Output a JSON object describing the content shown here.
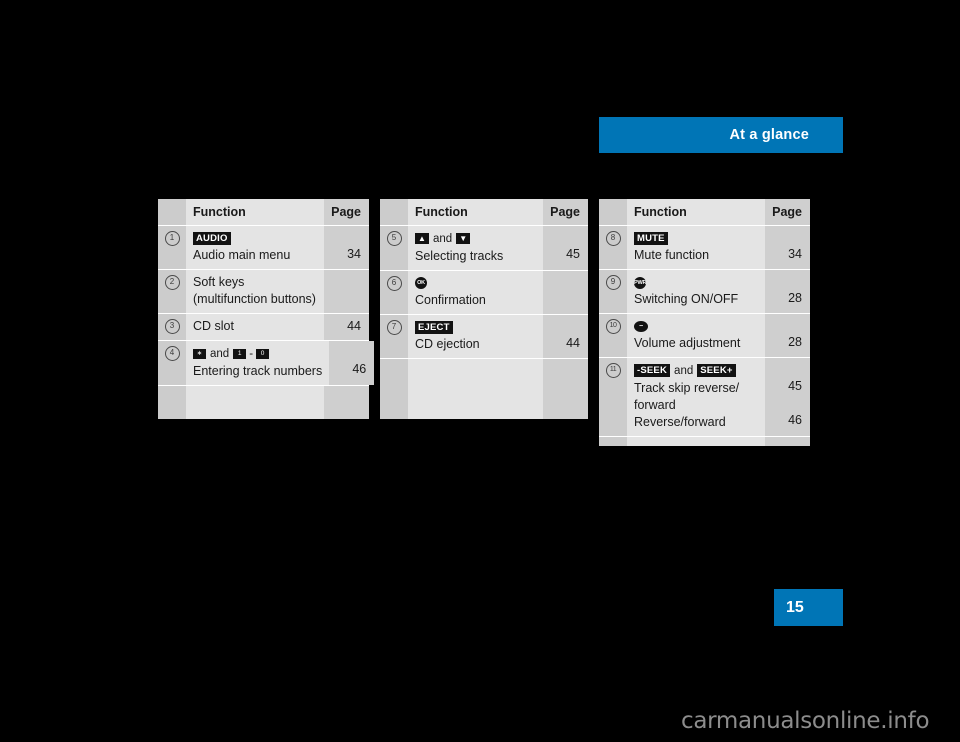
{
  "header": {
    "title": "At a glance",
    "bar_color": "#0075b6"
  },
  "page_marker": {
    "number": "15",
    "bar_color": "#0075b6"
  },
  "watermark": {
    "text": "carmanualsonline.info"
  },
  "tables": [
    {
      "id": "table-1",
      "columns": {
        "function": "Function",
        "page": "Page"
      },
      "rows": [
        {
          "num": "1",
          "badges": [
            {
              "kind": "label",
              "text": "AUDIO"
            }
          ],
          "lines": [
            "Audio main menu"
          ],
          "pages": [
            "34"
          ]
        },
        {
          "num": "2",
          "badges": [],
          "lines": [
            "Soft keys",
            "(multifunction buttons)"
          ],
          "pages": [
            "",
            ""
          ]
        },
        {
          "num": "3",
          "badges": [],
          "lines": [
            "CD slot"
          ],
          "pages": [
            "44"
          ]
        },
        {
          "num": "4",
          "badges": [
            {
              "kind": "key",
              "text": "∗"
            },
            {
              "kind": "conj",
              "text": "and"
            },
            {
              "kind": "key",
              "text": "1"
            },
            {
              "kind": "dash",
              "text": "-"
            },
            {
              "kind": "key",
              "text": "0"
            }
          ],
          "lines": [
            "Entering track numbers"
          ],
          "pages": [
            "46"
          ]
        }
      ]
    },
    {
      "id": "table-2",
      "columns": {
        "function": "Function",
        "page": "Page"
      },
      "rows": [
        {
          "num": "5",
          "badges": [
            {
              "kind": "arrow",
              "text": "▲"
            },
            {
              "kind": "conj",
              "text": "and"
            },
            {
              "kind": "arrow",
              "text": "▼"
            }
          ],
          "lines": [
            "Selecting tracks"
          ],
          "pages": [
            "45"
          ]
        },
        {
          "num": "6",
          "badges": [
            {
              "kind": "round",
              "text": "OK"
            }
          ],
          "lines": [
            "Confirmation"
          ],
          "pages": [
            ""
          ]
        },
        {
          "num": "7",
          "badges": [
            {
              "kind": "label",
              "text": "EJECT"
            }
          ],
          "lines": [
            "CD ejection"
          ],
          "pages": [
            "44"
          ]
        }
      ]
    },
    {
      "id": "table-3",
      "columns": {
        "function": "Function",
        "page": "Page"
      },
      "rows": [
        {
          "num": "8",
          "badges": [
            {
              "kind": "label",
              "text": "MUTE"
            }
          ],
          "lines": [
            "Mute function"
          ],
          "pages": [
            "34"
          ]
        },
        {
          "num": "9",
          "badges": [
            {
              "kind": "round",
              "text": "PWR"
            }
          ],
          "lines": [
            "Switching ON/OFF"
          ],
          "pages": [
            "28"
          ]
        },
        {
          "num": "10",
          "badges": [
            {
              "kind": "knob",
              "text": "−"
            }
          ],
          "lines": [
            "Volume adjustment"
          ],
          "pages": [
            "28"
          ]
        },
        {
          "num": "11",
          "badges": [
            {
              "kind": "label",
              "text": "-SEEK"
            },
            {
              "kind": "conj",
              "text": "and"
            },
            {
              "kind": "label",
              "text": "SEEK+"
            }
          ],
          "lines": [
            "Track skip reverse/",
            "forward",
            "Reverse/forward"
          ],
          "pages": [
            "45",
            "",
            "46"
          ]
        }
      ]
    }
  ]
}
